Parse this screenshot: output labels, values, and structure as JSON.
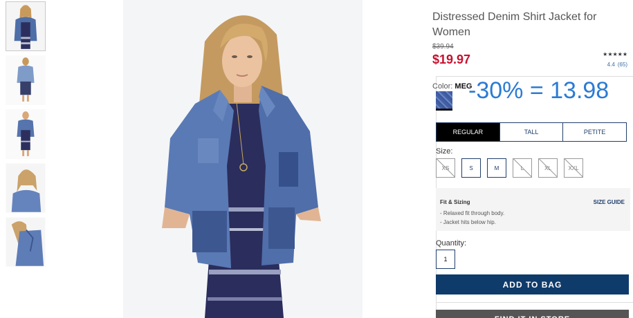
{
  "product": {
    "title": "Distressed Denim Shirt Jacket for Women",
    "old_price": "$39.94",
    "price": "$19.97",
    "stars": "★★★★★",
    "rating": "4.4",
    "reviews": "(65)"
  },
  "color": {
    "label": "Color:",
    "value": "MEG",
    "promo": "-30% = 13.98"
  },
  "fit_tabs": [
    "REGULAR",
    "TALL",
    "PETITE"
  ],
  "size": {
    "label": "Size:",
    "options": [
      "XS",
      "S",
      "M",
      "L",
      "XL",
      "XXL"
    ]
  },
  "fit_sizing": {
    "title": "Fit & Sizing",
    "guide": "SIZE GUIDE",
    "items": [
      "- Relaxed fit through body.",
      "- Jacket hits below hip."
    ]
  },
  "quantity": {
    "label": "Quantity:",
    "value": "1"
  },
  "buttons": {
    "add_to_bag": "ADD TO BAG",
    "find_store": "FIND IT IN STORE"
  },
  "colors": {
    "price_red": "#c8102e",
    "navy": "#0f3b6b",
    "promo_blue": "#2b7bd4"
  }
}
